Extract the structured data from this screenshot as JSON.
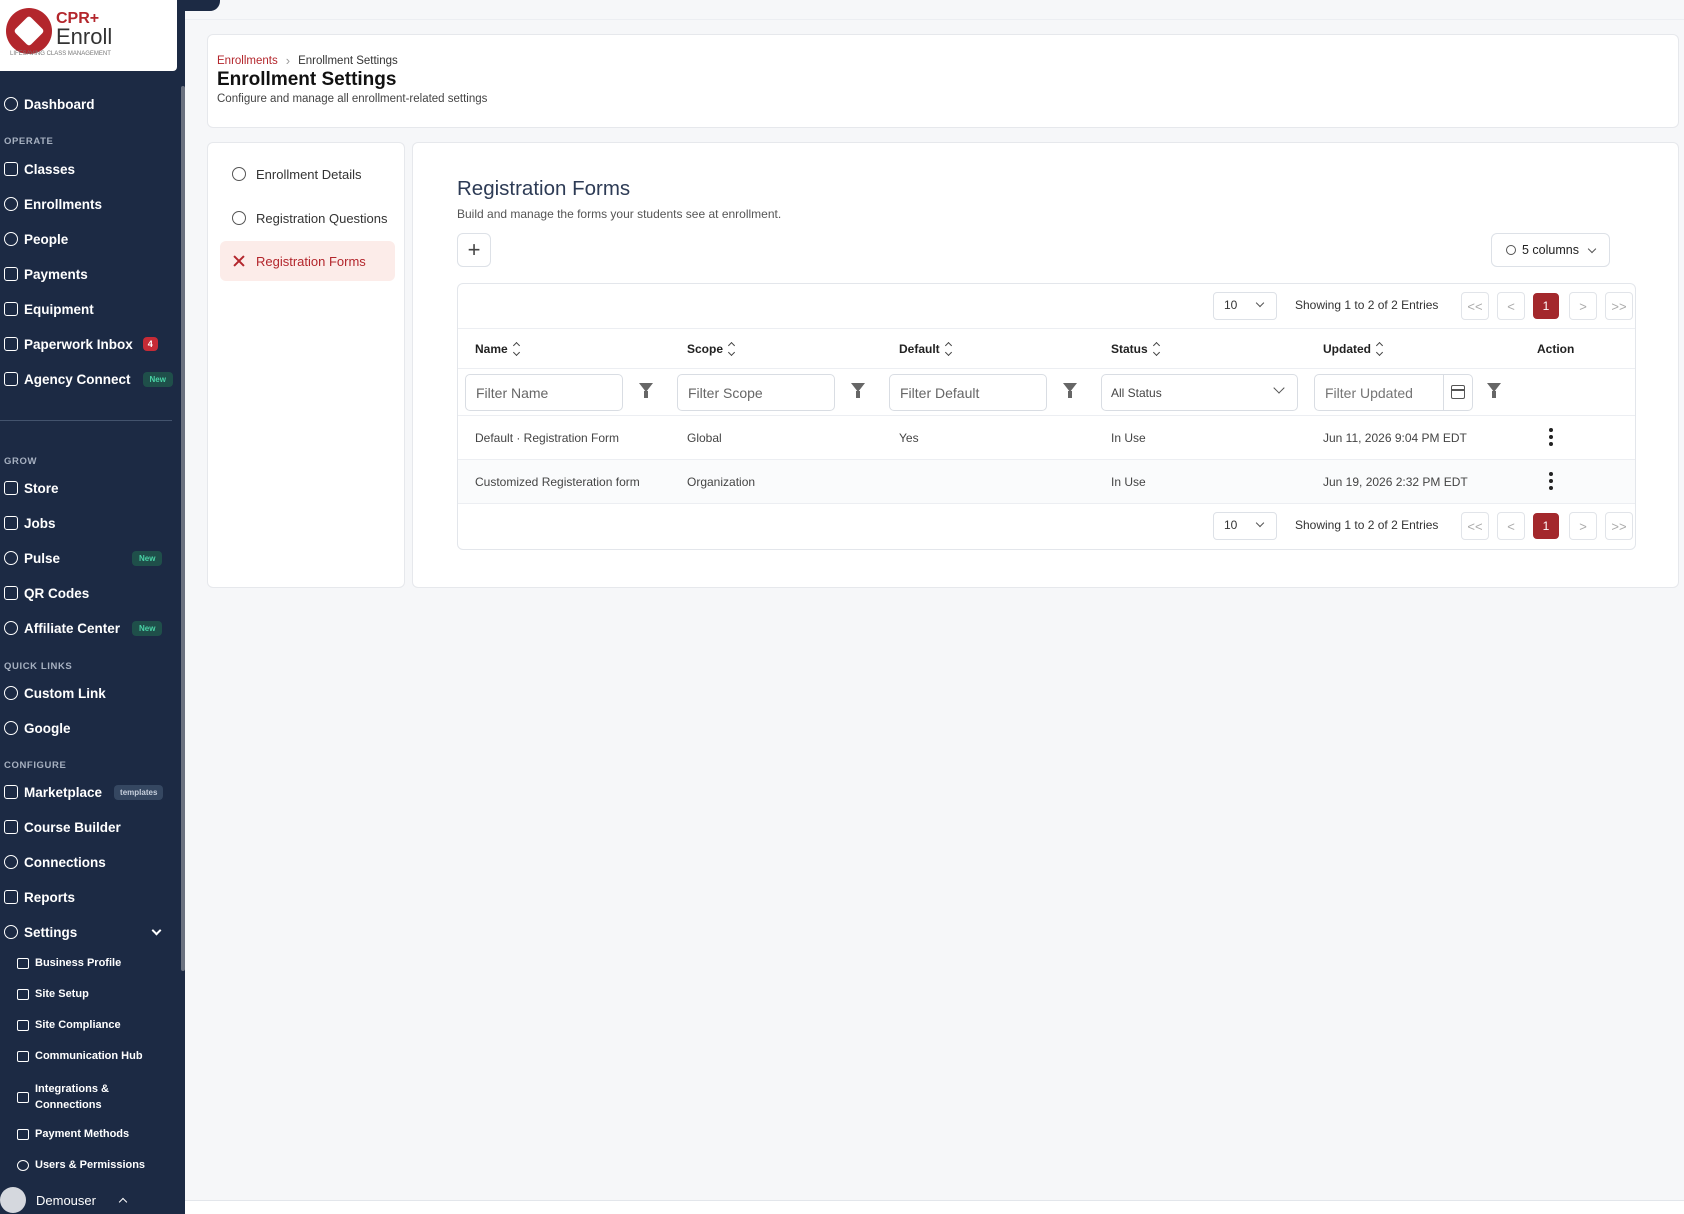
{
  "app": {
    "logo_top": "CPR+",
    "logo_bottom": "Enroll",
    "logo_tagline": "LIFESAVING CLASS MANAGEMENT"
  },
  "sidebar": {
    "dashboard": "Dashboard",
    "sections": {
      "operate": "OPERATE",
      "grow": "GROW",
      "quick_links": "QUICK LINKS",
      "configure": "CONFIGURE"
    },
    "operate_items": [
      {
        "label": "Classes",
        "icon": "book-icon"
      },
      {
        "label": "Enrollments",
        "icon": "user-icon"
      },
      {
        "label": "People",
        "icon": "user-circle-icon"
      },
      {
        "label": "Payments",
        "icon": "money-icon"
      },
      {
        "label": "Equipment",
        "icon": "boxes-icon"
      },
      {
        "label": "Paperwork Inbox",
        "icon": "inbox-icon",
        "badge": "4"
      },
      {
        "label": "Agency Connect",
        "icon": "rocket-icon",
        "badge": "New"
      }
    ],
    "grow_items": [
      {
        "label": "Store",
        "icon": "cart-icon"
      },
      {
        "label": "Jobs",
        "icon": "briefcase-icon"
      },
      {
        "label": "Pulse",
        "icon": "heart-pulse-icon",
        "badge": "New"
      },
      {
        "label": "QR Codes",
        "icon": "qr-icon"
      },
      {
        "label": "Affiliate Center",
        "icon": "handshake-icon",
        "badge": "New"
      }
    ],
    "quick_link_items": [
      {
        "label": "Custom Link",
        "icon": "link-icon"
      },
      {
        "label": "Google",
        "icon": "link-icon"
      }
    ],
    "configure_items": [
      {
        "label": "Marketplace",
        "icon": "store-icon",
        "badge": "templates"
      },
      {
        "label": "Course Builder",
        "icon": "graduation-icon"
      },
      {
        "label": "Connections",
        "icon": "plug-icon"
      },
      {
        "label": "Reports",
        "icon": "report-icon"
      },
      {
        "label": "Settings",
        "icon": "gear-icon"
      }
    ],
    "settings_sub_items": [
      "Business Profile",
      "Site Setup",
      "Site Compliance",
      "Communication Hub",
      "Integrations &\nConnections",
      "Payment Methods",
      "Users & Permissions"
    ],
    "user_name": "Demouser"
  },
  "header": {
    "breadcrumb_parent": "Enrollments",
    "breadcrumb_current": "Enrollment Settings",
    "title": "Enrollment Settings",
    "subtitle": "Configure and manage all enrollment-related settings"
  },
  "settings_nav": [
    {
      "label": "Enrollment Details",
      "icon": "user-gear-icon"
    },
    {
      "label": "Registration Questions",
      "icon": "question-circle-icon"
    },
    {
      "label": "Registration Forms",
      "icon": "tools-icon",
      "active": true
    }
  ],
  "main": {
    "title": "Registration Forms",
    "subtitle": "Build and manage the forms your students see at enrollment.",
    "add_label": "+",
    "columns_label": "5 columns",
    "page_size": "10",
    "entries_text": "Showing 1 to 2 of 2 Entries",
    "current_page": "1",
    "pager_first": "<<",
    "pager_prev": "<",
    "pager_next": ">",
    "pager_last": ">>"
  },
  "table": {
    "columns": [
      "Name",
      "Scope",
      "Default",
      "Status",
      "Updated",
      "Action"
    ],
    "filters": {
      "name_placeholder": "Filter Name",
      "scope_placeholder": "Filter Scope",
      "default_placeholder": "Filter Default",
      "status_selected": "All Status",
      "updated_placeholder": "Filter Updated"
    },
    "rows": [
      {
        "name": "Default · Registration Form",
        "scope": "Global",
        "default": "Yes",
        "status": "In Use",
        "updated": "Jun 11, 2026 9:04 PM EDT"
      },
      {
        "name": "Customized Registeration form",
        "scope": "Organization",
        "default": "",
        "status": "In Use",
        "updated": "Jun 19, 2026 2:32 PM EDT"
      }
    ]
  }
}
